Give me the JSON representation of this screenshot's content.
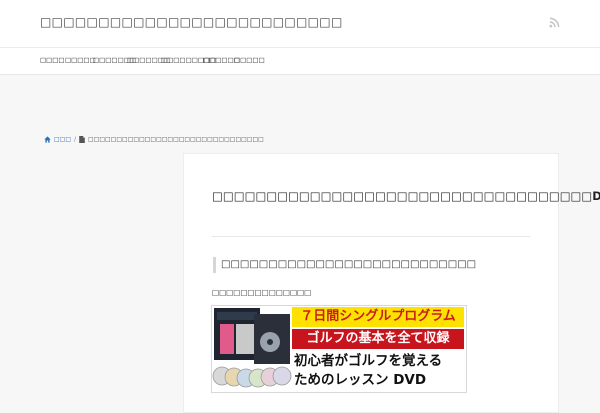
{
  "header": {
    "site_title": "□□□□□□□□□□□□□□□□□□□□□□□□□□",
    "rss_icon": "rss-icon"
  },
  "nav": {
    "items": [
      {
        "label": "□□□□"
      },
      {
        "label": "□□□□□"
      },
      {
        "label": "□□□□□□□"
      },
      {
        "label": "□□□□□□□"
      },
      {
        "label": "□□□□□□□□□"
      },
      {
        "label": "□□□□□□"
      },
      {
        "label": "□□□□□"
      }
    ]
  },
  "breadcrumb": {
    "home": "□□□",
    "separator": "/",
    "current": "□□□□□□□□□□□□□□□□□□□□□□□□□□□□□□□"
  },
  "post": {
    "title": "□□□□□□□□□□□□□□□□□□□□□□□□□□□□□□□□□□□DVD",
    "section_heading": "□□□□□□□□□□□□□□□□□□□□□□□□□□□",
    "caption": "□□□□□□□□□□□□□□",
    "banner": {
      "line1": "７日間シングルプログラム",
      "line2": "ゴルフの基本を全て収録",
      "line3": "初心者がゴルフを覚える",
      "line4": "ためのレッスン DVD"
    }
  },
  "colors": {
    "background": "#f7f7f7",
    "link": "#2a6fb5",
    "banner_yellow": "#ffe100",
    "banner_red": "#c8141c"
  }
}
